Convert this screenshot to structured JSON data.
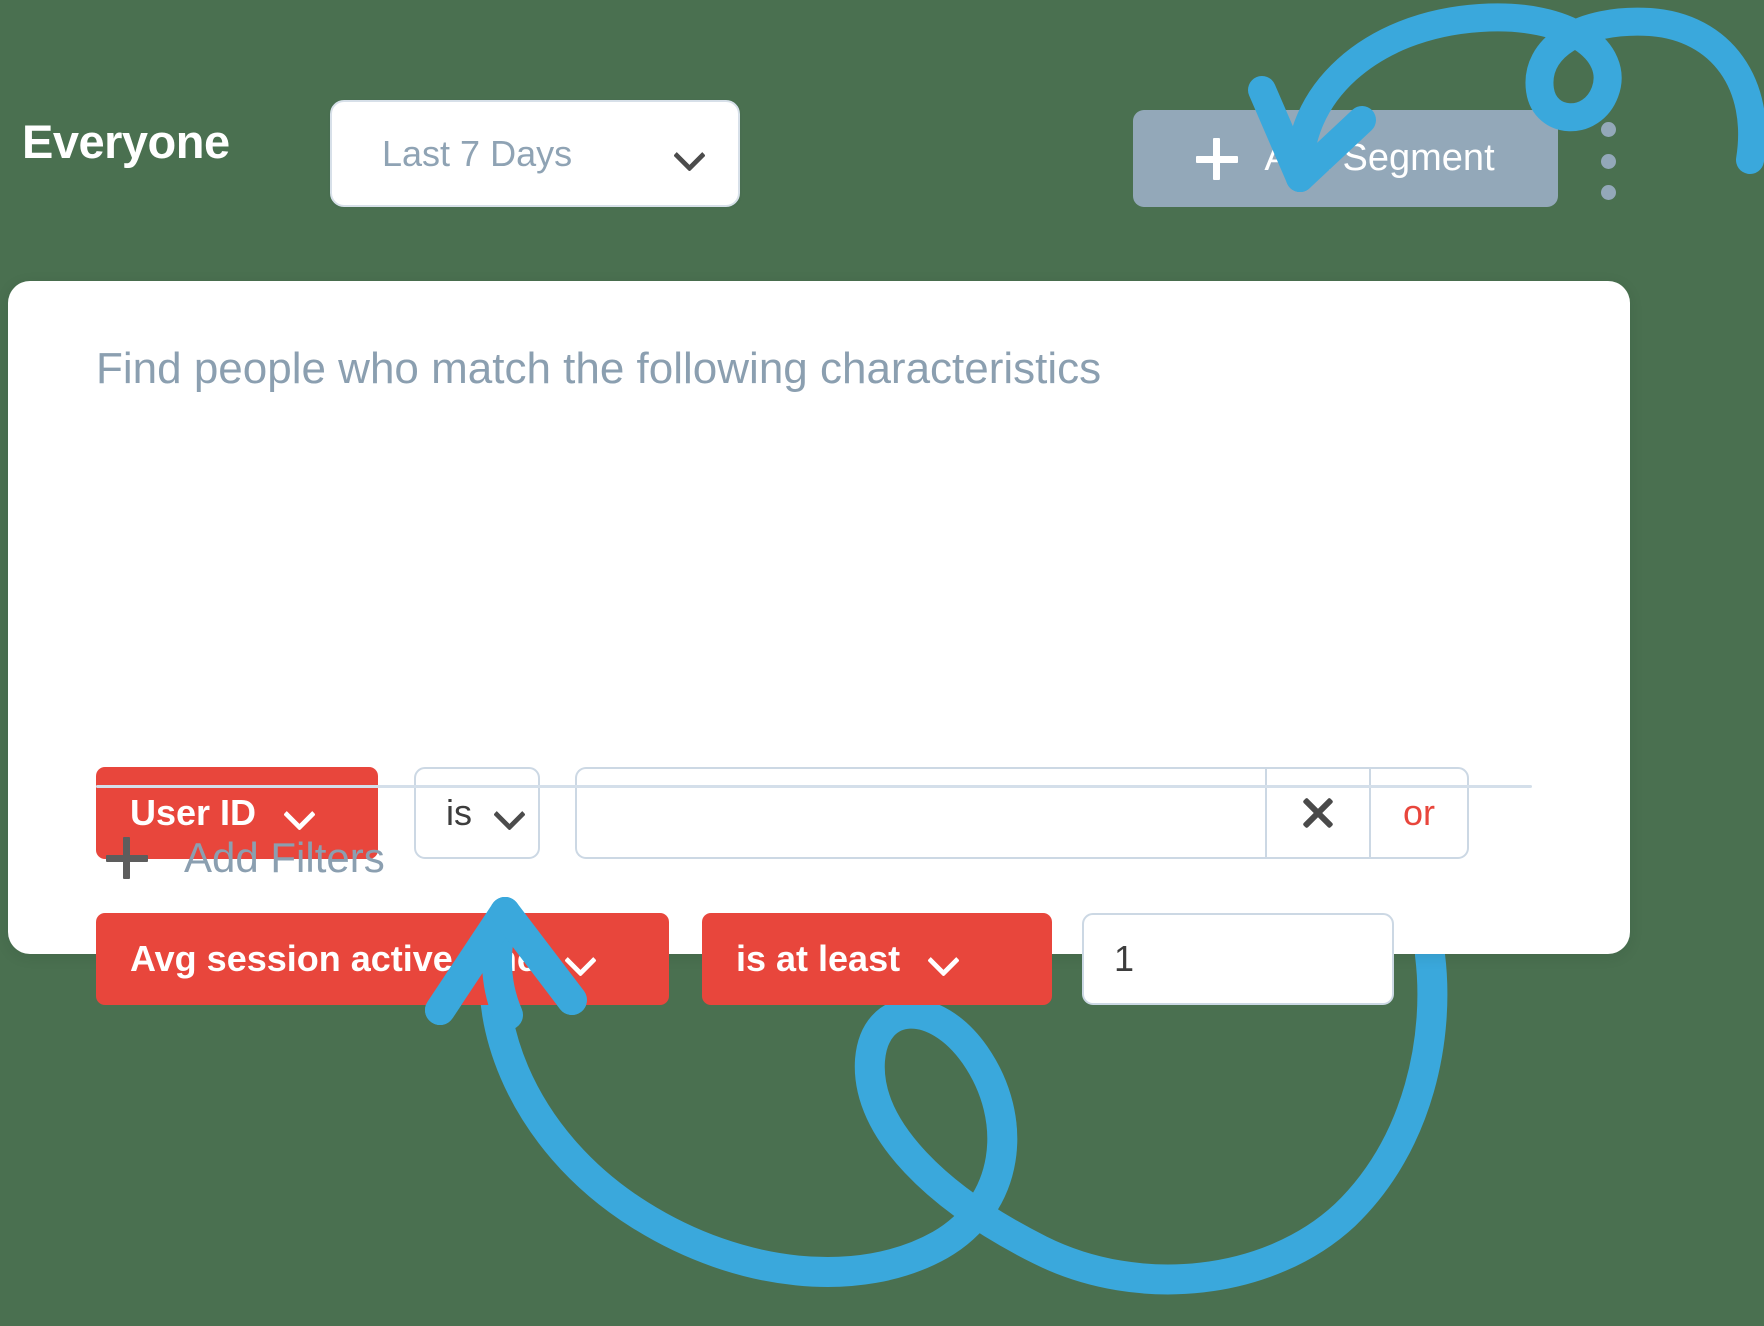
{
  "header": {
    "title": "Everyone",
    "date_range": {
      "selected": "Last 7 Days",
      "chevron_icon": "chevron-down-icon"
    },
    "add_segment": {
      "label": "Add Segment",
      "plus_icon": "plus-icon",
      "background_color": "#93a8b9"
    },
    "overflow_menu": {
      "icon": "kebab-menu-icon",
      "dot_color": "#93a8b9"
    }
  },
  "card": {
    "heading": "Find people who match the following characteristics",
    "filters": [
      {
        "attribute": "User ID",
        "operator": "is",
        "value": "",
        "value_placeholder": "",
        "clear_icon": "close-icon",
        "conjunction": "or"
      },
      {
        "attribute": "Avg session active time",
        "operator": "is at least",
        "value": "1"
      }
    ],
    "add_filters": {
      "label": "Add Filters",
      "plus_icon": "plus-icon"
    }
  },
  "colors": {
    "background": "#4a7050",
    "accent_red": "#e8463c",
    "accent_blue": "#3aa8dc",
    "muted_blue_gray": "#8b9fb0",
    "border": "#ccd8e4"
  },
  "annotations": {
    "arrow_top": "curved-arrow-pointing-to-add-segment",
    "arrow_bottom": "curved-arrow-pointing-to-add-filters"
  }
}
